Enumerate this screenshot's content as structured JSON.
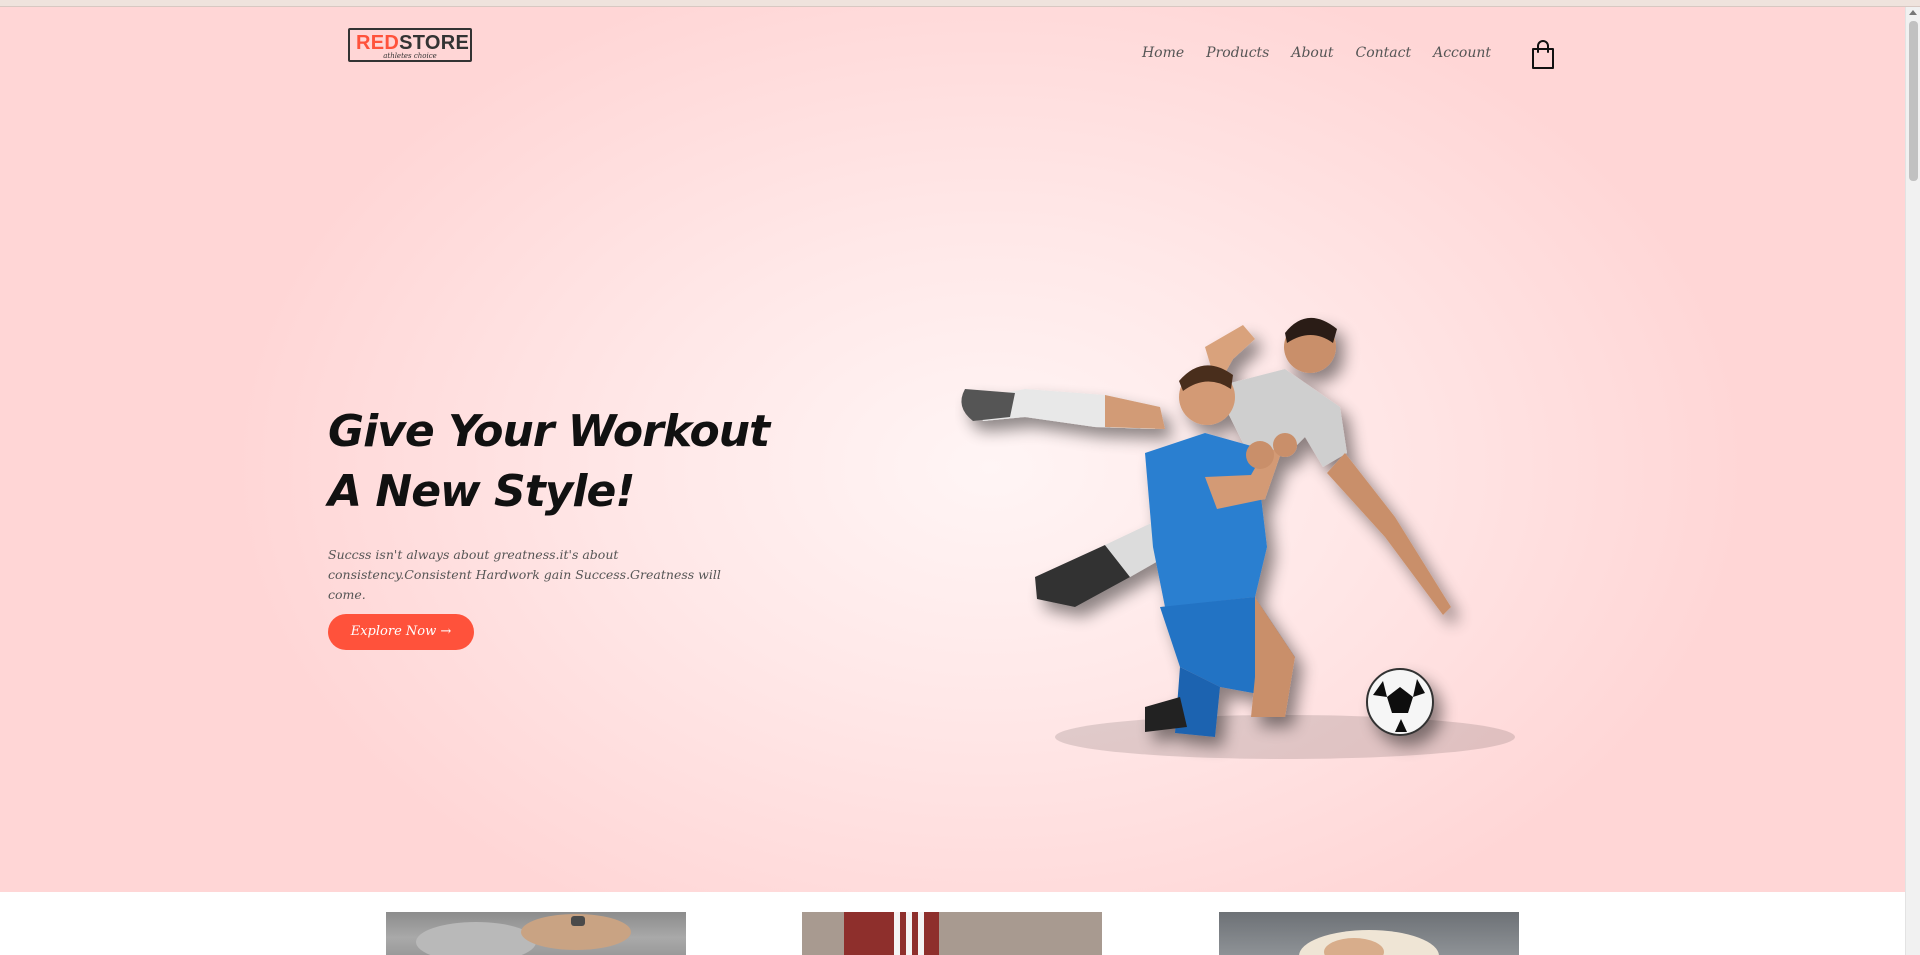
{
  "brand": {
    "logo_red": "RED",
    "logo_rest": "STORE",
    "tagline": "athletes choice",
    "accent_color": "#ff523b"
  },
  "nav": {
    "items": [
      "Home",
      "Products",
      "About",
      "Contact",
      "Account"
    ],
    "cart_icon": "shopping-bag-icon"
  },
  "hero": {
    "title_line1": "Give Your Workout",
    "title_line2": "A New Style!",
    "description": "Succss isn't always about greatness.it's about consistency.Consistent Hardwork gain Success.Greatness will come.",
    "button_label": "Explore Now →"
  },
  "featured": {
    "thumbnails": [
      "featured-image-1",
      "featured-image-2",
      "featured-image-3"
    ]
  }
}
